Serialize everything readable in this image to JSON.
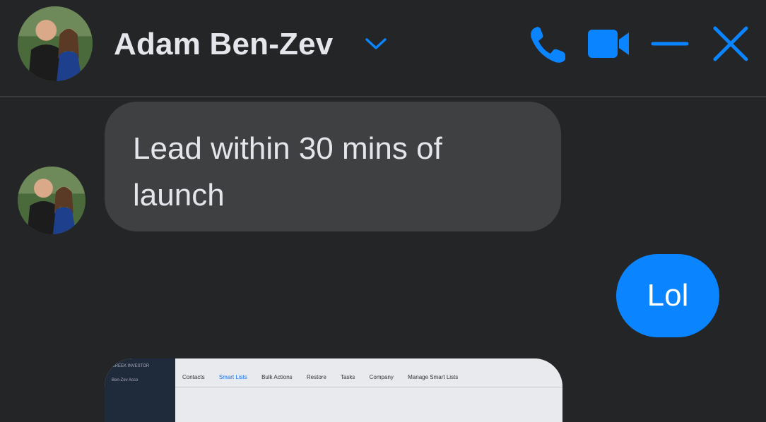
{
  "header": {
    "contact_name": "Adam Ben-Zev",
    "avatar_alt": "Profile photo of two people",
    "icons": {
      "chevron": "chevron-down-icon",
      "phone": "phone-icon",
      "video": "video-camera-icon",
      "minimize": "minimize-icon",
      "close": "close-icon"
    },
    "accent_color": "#0a84ff"
  },
  "messages": [
    {
      "direction": "incoming",
      "text": "Lead within 30 mins of launch"
    },
    {
      "direction": "outgoing",
      "text": "Lol"
    },
    {
      "direction": "incoming",
      "type": "image"
    }
  ],
  "attachment_preview": {
    "sidebar_title": "GREEK INVESTOR",
    "sidebar_item": "Ben-Zev Acco",
    "tabs": [
      "Contacts",
      "Smart Lists",
      "Bulk Actions",
      "Restore",
      "Tasks",
      "Company",
      "Manage Smart Lists"
    ]
  },
  "colors": {
    "background": "#242526",
    "incoming_bubble": "#3e4042",
    "outgoing_bubble": "#0a84ff"
  }
}
